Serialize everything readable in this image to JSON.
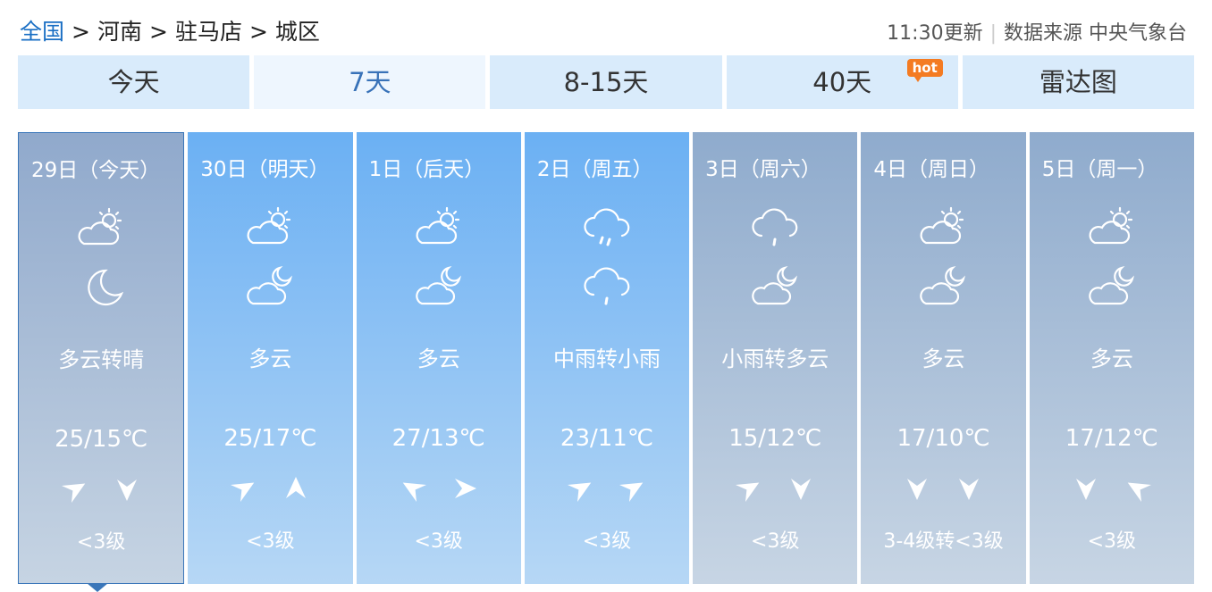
{
  "breadcrumb": {
    "home": "全国",
    "sep": ">",
    "province": "河南",
    "city": "驻马店",
    "district": "城区"
  },
  "meta": {
    "update": "11:30更新",
    "divider": "|",
    "source": "数据来源 中央气象台"
  },
  "tabs": [
    {
      "label": "今天"
    },
    {
      "label": "7天"
    },
    {
      "label": "8-15天"
    },
    {
      "label": "40天",
      "badge": "hot"
    },
    {
      "label": "雷达图"
    }
  ],
  "days": [
    {
      "date": "29日（今天）",
      "day_icon": "partly-cloudy-sun-icon",
      "night_icon": "crescent-moon-icon",
      "desc": "多云转晴",
      "temp": "25/15℃",
      "wind1": "arrow-icon",
      "wind2": "arrow-icon",
      "level": "<3级"
    },
    {
      "date": "30日（明天）",
      "day_icon": "partly-cloudy-sun-icon",
      "night_icon": "partly-cloudy-moon-icon",
      "desc": "多云",
      "temp": "25/17℃",
      "wind1": "arrow-icon",
      "wind2": "arrow-icon",
      "level": "<3级"
    },
    {
      "date": "1日（后天）",
      "day_icon": "partly-cloudy-sun-icon",
      "night_icon": "partly-cloudy-moon-icon",
      "desc": "多云",
      "temp": "27/13℃",
      "wind1": "arrow-icon",
      "wind2": "arrow-icon",
      "level": "<3级"
    },
    {
      "date": "2日（周五）",
      "day_icon": "rain-cloud-icon",
      "night_icon": "rain-cloud-icon",
      "desc": "中雨转小雨",
      "temp": "23/11℃",
      "wind1": "arrow-icon",
      "wind2": "arrow-icon",
      "level": "<3级"
    },
    {
      "date": "3日（周六）",
      "day_icon": "rain-cloud-icon",
      "night_icon": "partly-cloudy-moon-icon",
      "desc": "小雨转多云",
      "temp": "15/12℃",
      "wind1": "arrow-icon",
      "wind2": "arrow-icon",
      "level": "<3级"
    },
    {
      "date": "4日（周日）",
      "day_icon": "partly-cloudy-sun-icon",
      "night_icon": "partly-cloudy-moon-icon",
      "desc": "多云",
      "temp": "17/10℃",
      "wind1": "arrow-icon",
      "wind2": "arrow-icon",
      "level": "3-4级转<3级"
    },
    {
      "date": "5日（周一）",
      "day_icon": "partly-cloudy-sun-icon",
      "night_icon": "partly-cloudy-moon-icon",
      "desc": "多云",
      "temp": "17/12℃",
      "wind1": "arrow-icon",
      "wind2": "arrow-icon",
      "level": "<3级"
    }
  ]
}
